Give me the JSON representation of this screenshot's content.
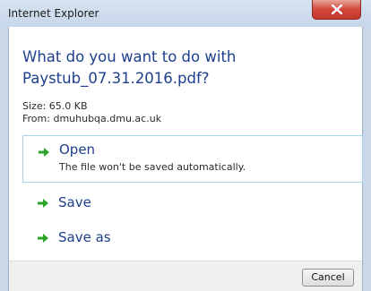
{
  "window": {
    "title": "Internet Explorer",
    "close_icon": "close-icon"
  },
  "dialog": {
    "heading_line1": "What do you want to do with",
    "heading_line2": "Paystub_07.31.2016.pdf?",
    "size_text": "Size: 65.0 KB",
    "from_text": "From: dmuhubqa.dmu.ac.uk"
  },
  "options": [
    {
      "label": "Open",
      "description": "The file won't be saved automatically.",
      "icon": "green-arrow-icon",
      "selected": true
    },
    {
      "label": "Save",
      "icon": "green-arrow-icon",
      "selected": false
    },
    {
      "label": "Save as",
      "icon": "green-arrow-icon",
      "selected": false
    }
  ],
  "footer": {
    "cancel_label": "Cancel"
  },
  "colors": {
    "heading_blue": "#1e3f8c",
    "arrow_green": "#2aa329",
    "close_red": "#c0392b",
    "selected_border": "#a7d6ea"
  }
}
